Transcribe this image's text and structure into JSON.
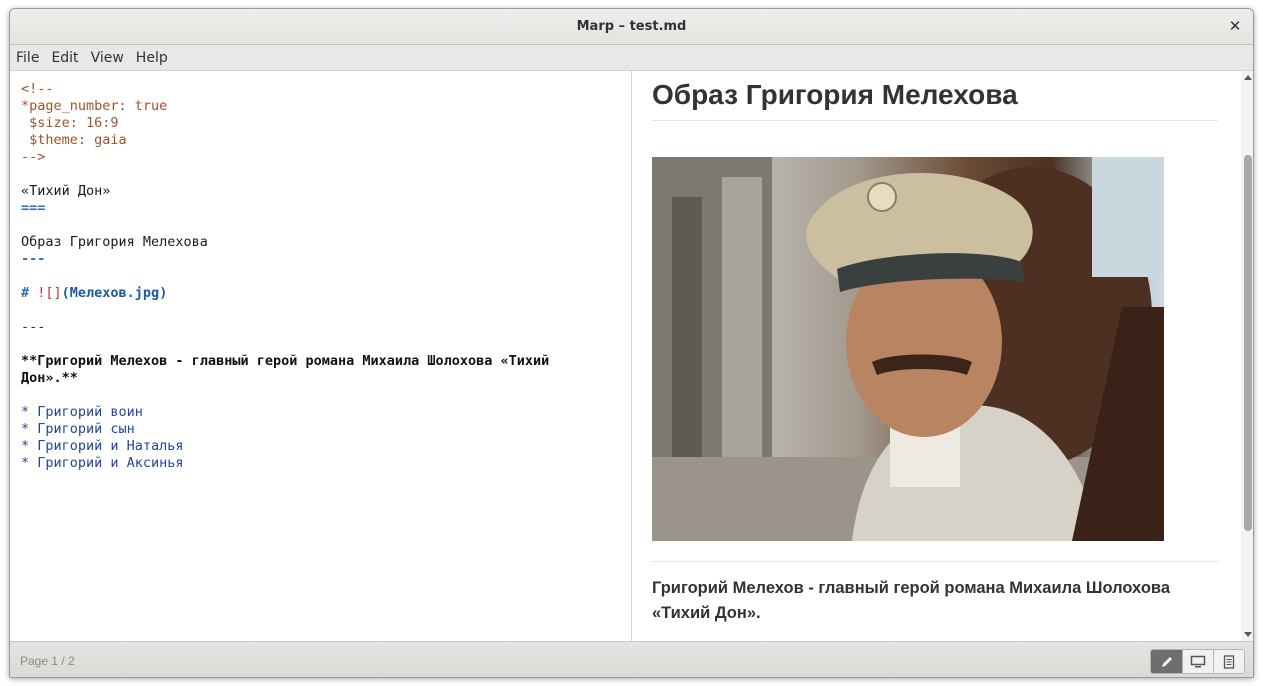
{
  "window": {
    "title": "Marp – test.md"
  },
  "menu": {
    "items": [
      "File",
      "Edit",
      "View",
      "Help"
    ]
  },
  "editor": {
    "lines": [
      {
        "segments": [
          {
            "text": "<!--",
            "style": "comment"
          }
        ]
      },
      {
        "segments": [
          {
            "text": "*page_number: true",
            "style": "comment"
          }
        ]
      },
      {
        "segments": [
          {
            "text": " $size: 16:9",
            "style": "comment"
          }
        ]
      },
      {
        "segments": [
          {
            "text": " $theme: gaia",
            "style": "comment"
          }
        ]
      },
      {
        "segments": [
          {
            "text": "-->",
            "style": "comment"
          }
        ]
      },
      {
        "segments": [
          {
            "text": "",
            "style": "plain"
          }
        ]
      },
      {
        "segments": [
          {
            "text": "«Тихий Дон»",
            "style": "plain"
          }
        ]
      },
      {
        "segments": [
          {
            "text": "===",
            "style": "heading"
          }
        ]
      },
      {
        "segments": [
          {
            "text": "",
            "style": "plain"
          }
        ]
      },
      {
        "segments": [
          {
            "text": "Образ Григория Мелехова",
            "style": "plain"
          }
        ]
      },
      {
        "segments": [
          {
            "text": "---",
            "style": "heading"
          }
        ]
      },
      {
        "segments": [
          {
            "text": "",
            "style": "plain"
          }
        ]
      },
      {
        "segments": [
          {
            "text": "# ",
            "style": "heading"
          },
          {
            "text": "![]",
            "style": "bracket"
          },
          {
            "text": "(Мелехов.jpg)",
            "style": "link"
          }
        ]
      },
      {
        "segments": [
          {
            "text": "",
            "style": "plain"
          }
        ]
      },
      {
        "segments": [
          {
            "text": "---",
            "style": "hr"
          }
        ]
      },
      {
        "segments": [
          {
            "text": "",
            "style": "plain"
          }
        ]
      },
      {
        "wrap": true,
        "segments": [
          {
            "text": "**Григорий Мелехов - главный герой романа Михаила Шолохова «Тихий Дон».**",
            "style": "bold"
          }
        ]
      },
      {
        "segments": [
          {
            "text": "",
            "style": "plain"
          }
        ]
      },
      {
        "segments": [
          {
            "text": "* Григорий воин",
            "style": "list"
          }
        ]
      },
      {
        "segments": [
          {
            "text": "* Григорий сын",
            "style": "list"
          }
        ]
      },
      {
        "segments": [
          {
            "text": "* Григорий и Наталья",
            "style": "list"
          }
        ]
      },
      {
        "segments": [
          {
            "text": "* Григорий и Аксинья",
            "style": "list"
          }
        ]
      }
    ]
  },
  "preview": {
    "heading": "Образ Григория Мелехова",
    "paragraph": "Григорий Мелехов - главный герой романа Михаила Шолохова «Тихий Дон»."
  },
  "status": {
    "page": "Page 1 / 2",
    "modes": [
      {
        "icon": "pencil-icon",
        "active": true
      },
      {
        "icon": "monitor-icon",
        "active": false
      },
      {
        "icon": "document-icon",
        "active": false
      }
    ]
  }
}
